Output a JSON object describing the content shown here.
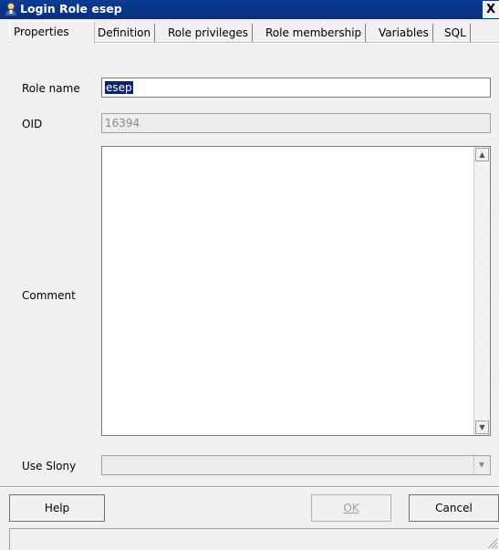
{
  "window": {
    "title": "Login Role esep",
    "close_glyph": "X",
    "icon": "user-icon"
  },
  "tabs": [
    {
      "label": "Properties",
      "active": true
    },
    {
      "label": "Definition",
      "active": false
    },
    {
      "label": "Role privileges",
      "active": false
    },
    {
      "label": "Role membership",
      "active": false
    },
    {
      "label": "Variables",
      "active": false
    },
    {
      "label": "SQL",
      "active": false
    }
  ],
  "form": {
    "role_name_label": "Role name",
    "role_name_value": "esep",
    "oid_label": "OID",
    "oid_value": "16394",
    "comment_label": "Comment",
    "comment_value": "",
    "use_slony_label": "Use Slony",
    "use_slony_value": ""
  },
  "buttons": {
    "help": "Help",
    "ok": "OK",
    "cancel": "Cancel"
  },
  "colors": {
    "titlebar": "#0b3c94",
    "selection": "#0a246a"
  }
}
